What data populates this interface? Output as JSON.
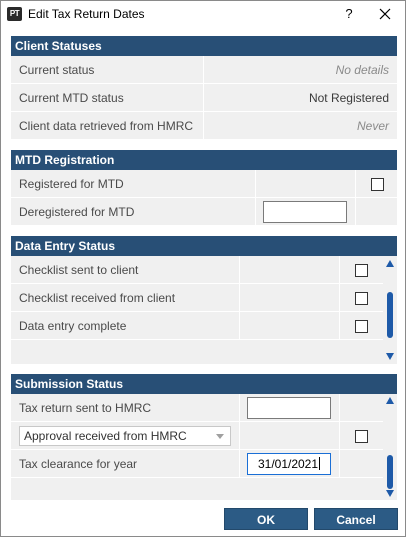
{
  "window": {
    "app_icon_text": "PT",
    "title": "Edit Tax Return Dates",
    "help_label": "?"
  },
  "client_statuses": {
    "header": "Client Statuses",
    "rows": [
      {
        "label": "Current status",
        "value": "No details"
      },
      {
        "label": "Current MTD status",
        "value": "Not Registered"
      },
      {
        "label": "Client data retrieved from HMRC",
        "value": "Never"
      }
    ]
  },
  "mtd_registration": {
    "header": "MTD Registration",
    "rows": [
      {
        "label": "Registered for MTD",
        "checked": false
      },
      {
        "label": "Deregistered for MTD",
        "date_value": ""
      }
    ]
  },
  "data_entry_status": {
    "header": "Data Entry Status",
    "rows": [
      {
        "label": "Checklist sent to client",
        "checked": false
      },
      {
        "label": "Checklist received from client",
        "checked": false
      },
      {
        "label": "Data entry complete",
        "checked": false
      }
    ]
  },
  "submission_status": {
    "header": "Submission Status",
    "rows": [
      {
        "label": "Tax return sent to HMRC",
        "date_value": ""
      },
      {
        "label": "Approval received from HMRC",
        "type": "dropdown",
        "checked": false
      },
      {
        "label": "Tax clearance for year",
        "date_value": "31/01/2021"
      }
    ]
  },
  "buttons": {
    "ok": "OK",
    "cancel": "Cancel"
  },
  "colors": {
    "section_header": "#284f76",
    "button": "#2c5b85",
    "scrollbar": "#1e5aa8"
  }
}
